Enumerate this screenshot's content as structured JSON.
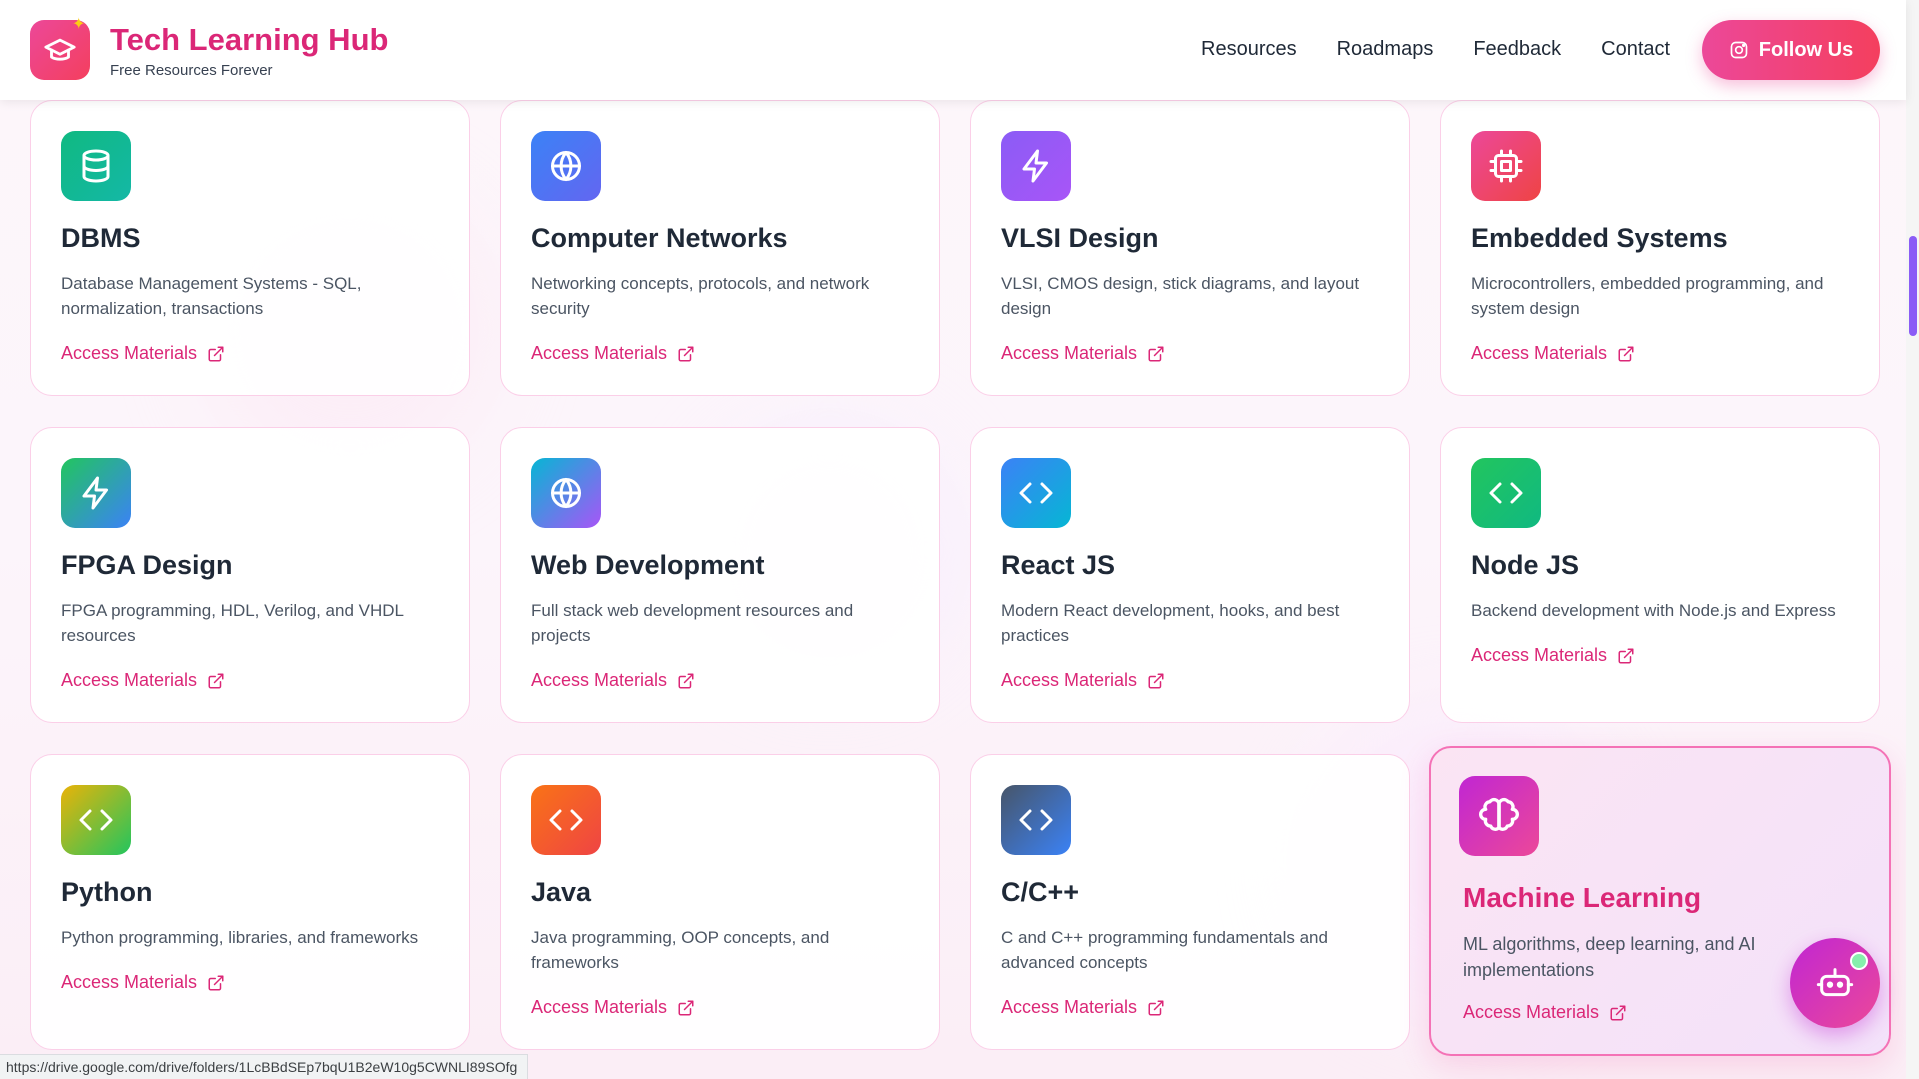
{
  "header": {
    "brand_title": "Tech Learning Hub",
    "brand_subtitle": "Free Resources Forever",
    "nav": [
      "Resources",
      "Roadmaps",
      "Feedback",
      "Contact"
    ],
    "follow_label": "Follow Us"
  },
  "cards": [
    {
      "title": "DBMS",
      "desc": "Database Management Systems - SQL, normalization, transactions",
      "link": "Access Materials",
      "icon": "database-icon",
      "gradient": [
        "#10b981",
        "#14b8a6"
      ]
    },
    {
      "title": "Computer Networks",
      "desc": "Networking concepts, protocols, and network security",
      "link": "Access Materials",
      "icon": "globe-icon",
      "gradient": [
        "#3b82f6",
        "#6366f1"
      ]
    },
    {
      "title": "VLSI Design",
      "desc": "VLSI, CMOS design, stick diagrams, and layout design",
      "link": "Access Materials",
      "icon": "lightning-icon",
      "gradient": [
        "#8b5cf6",
        "#a855f7"
      ]
    },
    {
      "title": "Embedded Systems",
      "desc": "Microcontrollers, embedded programming, and system design",
      "link": "Access Materials",
      "icon": "cpu-icon",
      "gradient": [
        "#ec4899",
        "#ef4444"
      ]
    },
    {
      "title": "FPGA Design",
      "desc": "FPGA programming, HDL, Verilog, and VHDL resources",
      "link": "Access Materials",
      "icon": "lightning-icon",
      "gradient": [
        "#22c55e",
        "#3b82f6"
      ]
    },
    {
      "title": "Web Development",
      "desc": "Full stack web development resources and projects",
      "link": "Access Materials",
      "icon": "globe-icon",
      "gradient": [
        "#06b6d4",
        "#a855f7"
      ]
    },
    {
      "title": "React JS",
      "desc": "Modern React development, hooks, and best practices",
      "link": "Access Materials",
      "icon": "code-icon",
      "gradient": [
        "#3b82f6",
        "#06b6d4"
      ]
    },
    {
      "title": "Node JS",
      "desc": "Backend development with Node.js and Express",
      "link": "Access Materials",
      "icon": "code-icon",
      "gradient": [
        "#22c55e",
        "#10b981"
      ]
    },
    {
      "title": "Python",
      "desc": "Python programming, libraries, and frameworks",
      "link": "Access Materials",
      "icon": "code-icon",
      "gradient": [
        "#eab308",
        "#22c55e"
      ]
    },
    {
      "title": "Java",
      "desc": "Java programming, OOP concepts, and frameworks",
      "link": "Access Materials",
      "icon": "code-icon",
      "gradient": [
        "#f97316",
        "#ef4444"
      ]
    },
    {
      "title": "C/C++",
      "desc": "C and C++ programming fundamentals and advanced concepts",
      "link": "Access Materials",
      "icon": "code-icon",
      "gradient": [
        "#475569",
        "#3b82f6"
      ]
    },
    {
      "title": "Machine Learning",
      "desc": "ML algorithms, deep learning, and AI implementations",
      "link": "Access Materials",
      "icon": "brain-icon",
      "gradient": [
        "#c026d3",
        "#ec4899"
      ],
      "featured": true
    }
  ],
  "status_url": "https://drive.google.com/drive/folders/1LcBBdSEp7bqU1B2eW10g5CWNLI89SOfg"
}
